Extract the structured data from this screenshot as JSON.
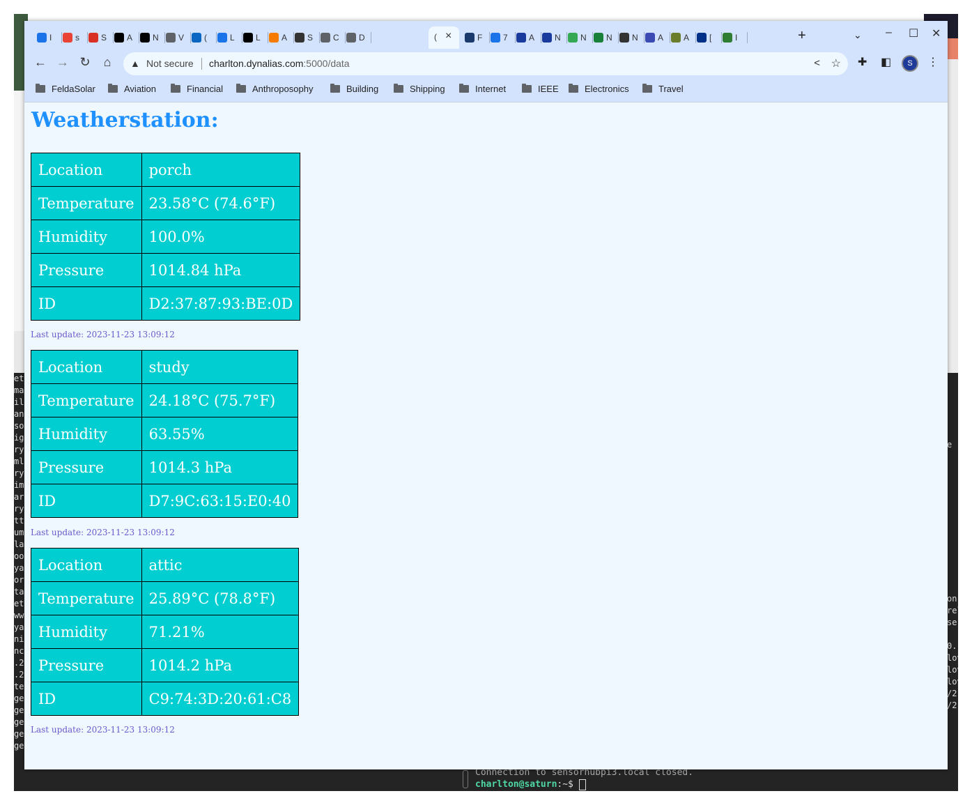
{
  "terminal": {
    "left_fragments": [
      "et",
      "ma",
      "il",
      "an",
      "so",
      "ig",
      "ry",
      "ml",
      "ry",
      "im",
      "ar",
      "ry",
      "tt",
      "um",
      "la",
      "oo",
      "ya",
      "or",
      "ta",
      "et",
      "ww",
      "ya",
      "ni",
      "nc",
      ".2",
      ".2",
      "te",
      "ge",
      "ge",
      "ge",
      "ge",
      "ge"
    ],
    "right_fragments": [
      "e",
      "",
      "",
      "",
      "",
      "",
      "",
      "",
      "",
      "",
      "",
      "",
      "",
      "on",
      "rel",
      "se",
      "",
      "0.",
      "lov",
      "lov",
      "lov",
      "/2",
      "/2"
    ],
    "last_line": "Connection to sensorhubpi3.local closed.",
    "prompt": "charlton@saturn",
    "prompt_suffix": ":~$"
  },
  "browser": {
    "tabs": [
      {
        "label": "I",
        "icon": "calendar-icon",
        "color": "#1a73e8"
      },
      {
        "label": "s",
        "icon": "gmail-icon",
        "color": "#ea4335"
      },
      {
        "label": "S",
        "icon": "magnet-icon",
        "color": "#d93025"
      },
      {
        "label": "A",
        "icon": "font-icon",
        "color": "#000000"
      },
      {
        "label": "N",
        "icon": "box-icon",
        "color": "#000000"
      },
      {
        "label": "V",
        "icon": "globe-icon",
        "color": "#5f6368"
      },
      {
        "label": "(",
        "icon": "linkedin-icon",
        "color": "#0a66c2"
      },
      {
        "label": "L",
        "icon": "radio-icon",
        "color": "#1a73e8"
      },
      {
        "label": "L",
        "icon": "chart-icon",
        "color": "#000000"
      },
      {
        "label": "A",
        "icon": "filter-icon",
        "color": "#f57c00"
      },
      {
        "label": "S",
        "icon": "gear-icon",
        "color": "#333333"
      },
      {
        "label": "C",
        "icon": "key-icon",
        "color": "#5f6368"
      },
      {
        "label": "D",
        "icon": "globe-icon",
        "color": "#5f6368"
      },
      {
        "label": "F",
        "icon": "plane-icon",
        "color": "#1a3a6e"
      },
      {
        "label": "7",
        "icon": "noaa-icon",
        "color": "#1a73e8"
      },
      {
        "label": "A",
        "icon": "noaa-icon",
        "color": "#1a3a9e"
      },
      {
        "label": "N",
        "icon": "noaa-icon",
        "color": "#1a3a9e"
      },
      {
        "label": "N",
        "icon": "drive-icon",
        "color": "#34a853"
      },
      {
        "label": "N",
        "icon": "plus-icon",
        "color": "#188038"
      },
      {
        "label": "N",
        "icon": "github-icon",
        "color": "#333333"
      },
      {
        "label": "A",
        "icon": "flag-icon",
        "color": "#3c4bb4"
      },
      {
        "label": "A",
        "icon": "seal-icon",
        "color": "#6b7d2a"
      },
      {
        "label": "[",
        "icon": "paypal-icon",
        "color": "#003087"
      },
      {
        "label": "I",
        "icon": "homeassistant-icon",
        "color": "#2e7d32"
      }
    ],
    "active_tab_label": "(",
    "address": {
      "security": "Not secure",
      "host": "charlton.dynalias.com",
      "rest": ":5000/data"
    },
    "profile_initial": "S",
    "bookmarks": [
      "FeldaSolar",
      "Aviation",
      "Financial",
      "Anthroposophy",
      "Building",
      "Shipping",
      "Internet",
      "IEEE",
      "Electronics",
      "Travel"
    ]
  },
  "page": {
    "title": "Weatherstation:",
    "stations": [
      {
        "rows": [
          [
            "Location",
            "porch"
          ],
          [
            "Temperature",
            "23.58°C (74.6°F)"
          ],
          [
            "Humidity",
            "100.0%"
          ],
          [
            "Pressure",
            "1014.84 hPa"
          ],
          [
            "ID",
            "D2:37:87:93:BE:0D"
          ]
        ],
        "update": "Last update: 2023-11-23 13:09:12"
      },
      {
        "rows": [
          [
            "Location",
            "study"
          ],
          [
            "Temperature",
            "24.18°C (75.7°F)"
          ],
          [
            "Humidity",
            "63.55%"
          ],
          [
            "Pressure",
            "1014.3 hPa"
          ],
          [
            "ID",
            "D7:9C:63:15:E0:40"
          ]
        ],
        "update": "Last update: 2023-11-23 13:09:12"
      },
      {
        "rows": [
          [
            "Location",
            "attic"
          ],
          [
            "Temperature",
            "25.89°C (78.8°F)"
          ],
          [
            "Humidity",
            "71.21%"
          ],
          [
            "Pressure",
            "1014.2 hPa"
          ],
          [
            "ID",
            "C9:74:3D:20:61:C8"
          ]
        ],
        "update": "Last update: 2023-11-23 13:09:12"
      }
    ]
  }
}
